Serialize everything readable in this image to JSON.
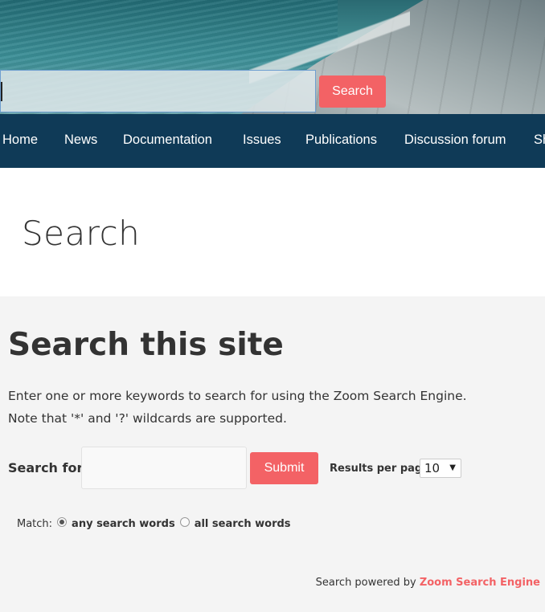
{
  "header": {
    "search_button": "Search"
  },
  "nav": {
    "items": [
      "Home",
      "News",
      "Documentation",
      "Issues",
      "Publications",
      "Discussion forum",
      "Sh"
    ]
  },
  "page": {
    "title": "Search"
  },
  "search_form": {
    "heading": "Search this site",
    "intro_line1": "Enter one or more keywords to search for using the Zoom Search Engine.",
    "intro_line2": "Note that '*' and '?' wildcards are supported.",
    "search_for_label": "Search for:",
    "submit_label": "Submit",
    "results_per_page_label": "Results per page:",
    "results_per_page_value": "10",
    "match_label": "Match:",
    "match_any": "any search words",
    "match_all": "all search words",
    "powered_prefix": "Search powered by",
    "powered_link": "Zoom Search Engine"
  },
  "colors": {
    "accent": "#f36265",
    "nav_bg": "#0f3a57"
  }
}
